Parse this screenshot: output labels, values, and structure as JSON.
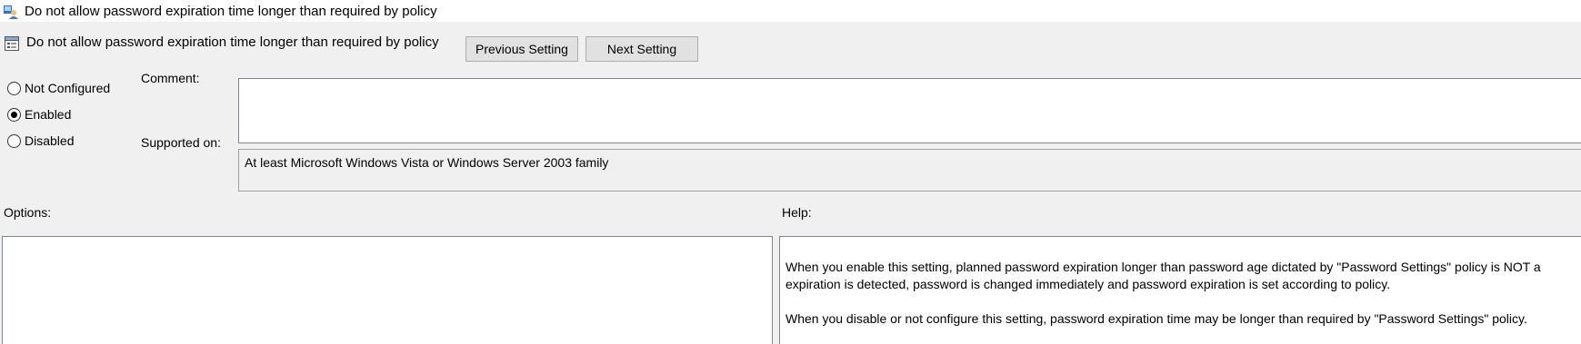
{
  "window": {
    "title": "Do not allow password expiration time longer than required by policy",
    "app_icon": "group-policy-icon"
  },
  "header": {
    "policy_name": "Do not allow password expiration time longer than required by policy",
    "policy_icon": "policy-setting-icon",
    "previous_label": "Previous Setting",
    "next_label": "Next Setting"
  },
  "state": {
    "options": [
      {
        "label": "Not Configured",
        "checked": false
      },
      {
        "label": "Enabled",
        "checked": true
      },
      {
        "label": "Disabled",
        "checked": false
      }
    ]
  },
  "comment": {
    "label": "Comment:",
    "value": ""
  },
  "supported": {
    "label": "Supported on:",
    "value": "At least Microsoft Windows Vista or Windows Server 2003 family"
  },
  "options_panel": {
    "label": "Options:"
  },
  "help_panel": {
    "label": "Help:",
    "paragraphs": [
      "When you enable this setting, planned password expiration longer than password age dictated by \"Password Settings\" policy is NOT a",
      "expiration is detected, password is changed immediately and password expiration is set according to policy.",
      "When you disable or not configure this setting, password expiration time may be longer than required by \"Password Settings\" policy."
    ]
  }
}
